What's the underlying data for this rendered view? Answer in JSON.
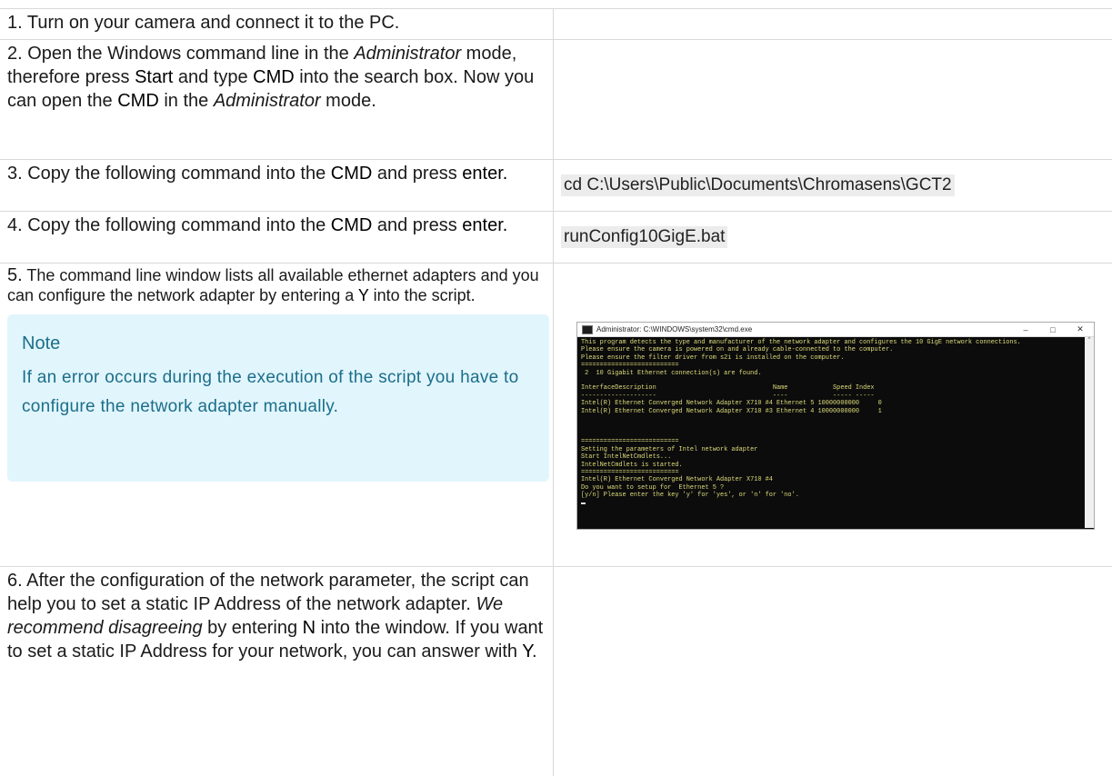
{
  "steps": {
    "s1": {
      "text": "1. Turn on your camera and connect it to the PC."
    },
    "s2": {
      "p1": "2. Open the Windows command line in the ",
      "em1": "Administrator",
      "p2": " mode, therefore press ",
      "b1": "Start",
      "p3": " and type ",
      "b2": "CMD",
      "p4": " into the search box. Now you can open the ",
      "b3": "CMD",
      "p5": " in the ",
      "em2": "Administrator",
      "p6": " mode."
    },
    "s3": {
      "p1": "3. Copy the following command into the ",
      "b1": "CMD",
      "p2": " and press ",
      "b2": "enter.",
      "code": "cd C:\\Users\\Public\\Documents\\Chromasens\\GCT2"
    },
    "s4": {
      "p1": "4. Copy the following command into the ",
      "b1": "CMD",
      "p2": " and press ",
      "b2": "enter.",
      "code": "runConfig10GigE.bat"
    },
    "s5": {
      "num": "5.",
      "p1": " The command line window lists all available ethernet adapters and you can configure the network adapter by entering a ",
      "b1": "Y",
      "p2": " into the script.",
      "note_title": "Note",
      "note_body": "If an error occurs during the execution of the script you have to configure the network adapter manually."
    },
    "s6": {
      "p1": "6. After the configuration of the network parameter, the script can help you to set a static IP Address of the network adapter. ",
      "em1": "We recommend disagreeing",
      "p2": " by entering ",
      "b1": "N",
      "p3": " into the window. If you want to set a static IP Address for your network, you can answer with ",
      "b2": "Y",
      "p4": "."
    }
  },
  "console": {
    "title": "Administrator: C:\\WINDOWS\\system32\\cmd.exe",
    "minimize": "–",
    "maximize": "□",
    "close": "✕",
    "lines": [
      "This program detects the type and manufacturer of the network adapter and configures the 10 GigE network connections.",
      "Please ensure the camera is powered on and already cable-connected to the computer.",
      "Please ensure the filter driver from s2i is installed on the computer.",
      "==========================",
      " 2  10 Gigabit Ethernet connection(s) are found.",
      "",
      "InterfaceDescription                               Name            Speed Index",
      "--------------------                               ----            ----- -----",
      "Intel(R) Ethernet Converged Network Adapter X710 #4 Ethernet 5 10000000000     0",
      "Intel(R) Ethernet Converged Network Adapter X710 #3 Ethernet 4 10000000000     1",
      "",
      "",
      "",
      "==========================",
      "Setting the parameters of Intel network adapter",
      "Start IntelNetCmdlets...",
      "IntelNetCmdlets is started.",
      "==========================",
      "Intel(R) Ethernet Converged Network Adapter X710 #4",
      "Do you want to setup for  Ethernet 5 ?",
      "[y/n] Please enter the key 'y' for 'yes', or 'n' for 'no'."
    ]
  }
}
